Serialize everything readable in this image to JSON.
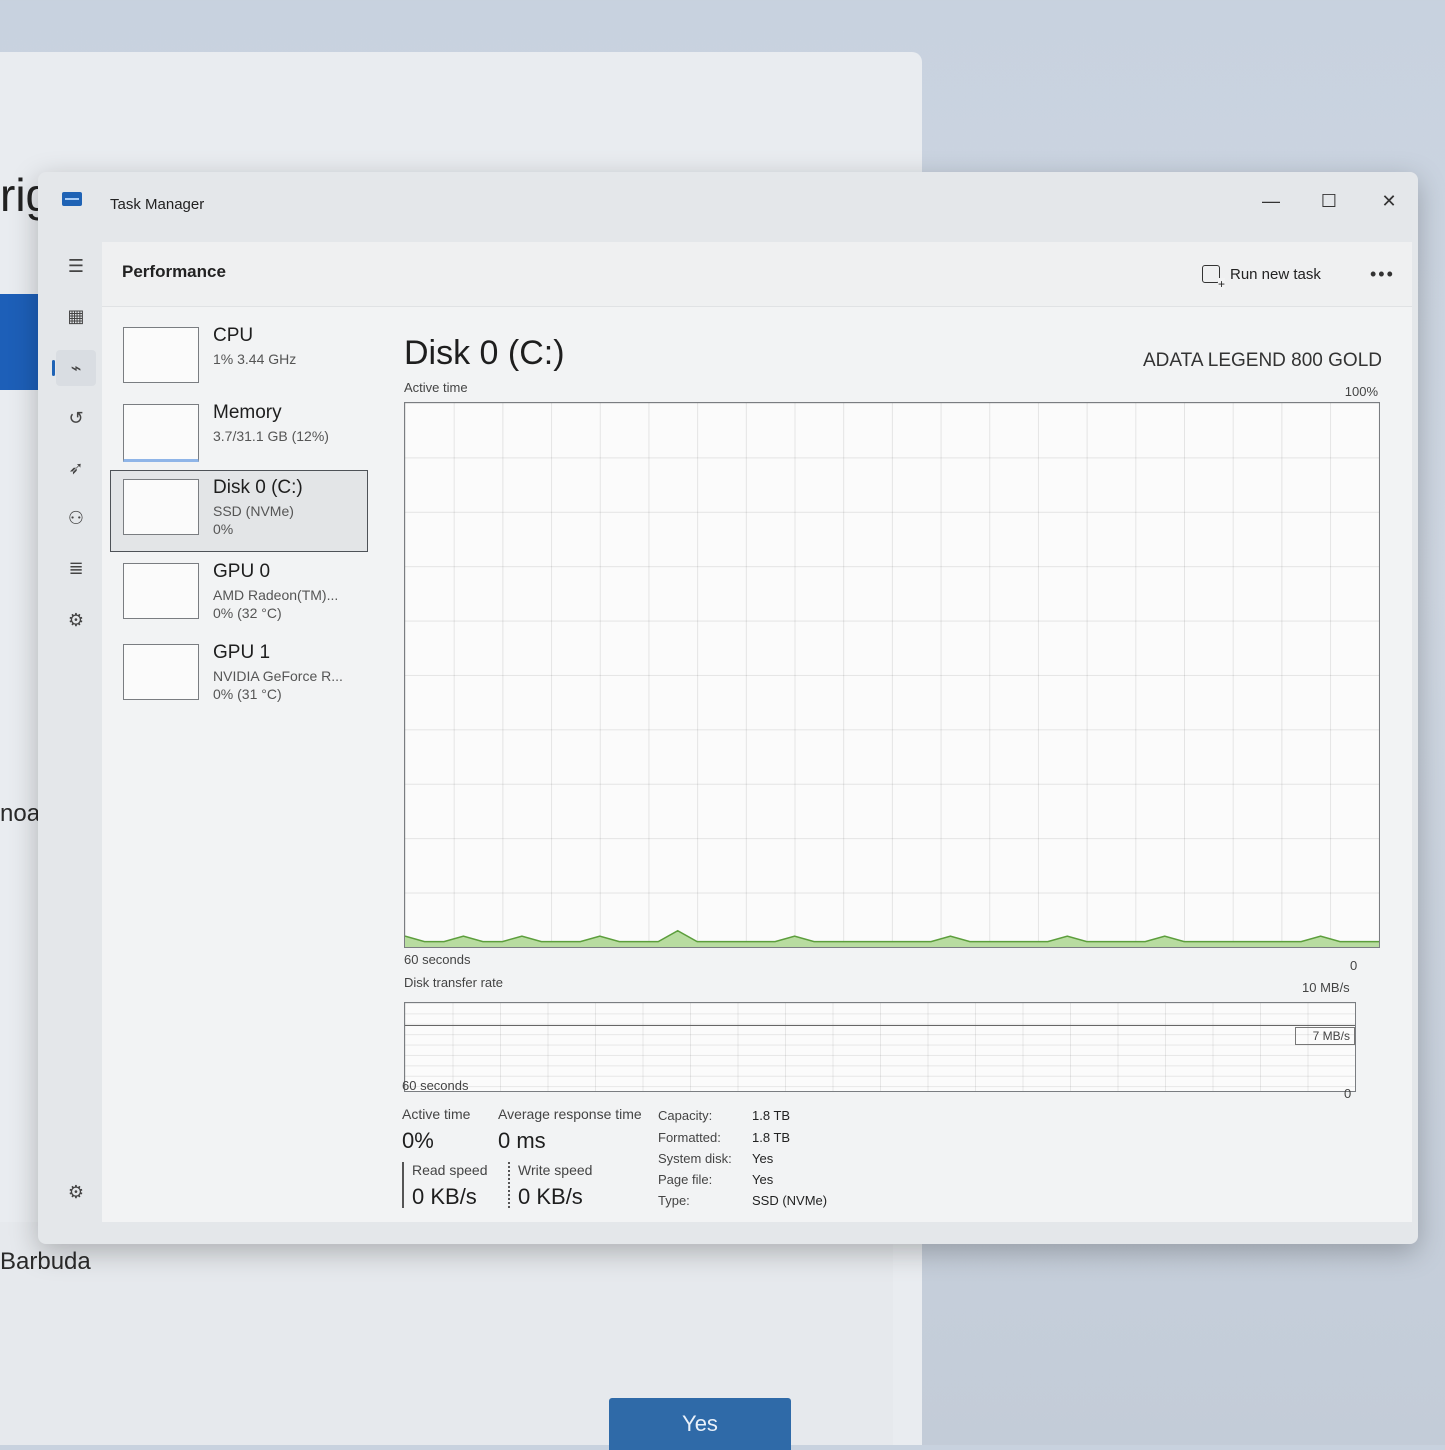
{
  "background": {
    "heading_fragment": "rig",
    "text_fragment_1": "noa",
    "text_fragment_2": "Barbuda",
    "yes_label": "Yes"
  },
  "window": {
    "title": "Task Manager",
    "minimize": "—",
    "maximize": "☐",
    "close": "✕"
  },
  "nav": [
    {
      "name": "hamburger-menu-icon",
      "glyph": "☰"
    },
    {
      "name": "processes-icon",
      "glyph": "▦"
    },
    {
      "name": "performance-icon",
      "glyph": "⌁"
    },
    {
      "name": "app-history-icon",
      "glyph": "↺"
    },
    {
      "name": "startup-apps-icon",
      "glyph": "➶"
    },
    {
      "name": "users-icon",
      "glyph": "⚇"
    },
    {
      "name": "details-icon",
      "glyph": "≣"
    },
    {
      "name": "services-icon",
      "glyph": "⚙"
    },
    {
      "name": "settings-icon",
      "glyph": "⚙"
    }
  ],
  "header": {
    "title": "Performance",
    "run_new_task": "Run new task",
    "more": "•••"
  },
  "devices": [
    {
      "name": "CPU",
      "sub1": "1% 3.44 GHz",
      "sub2": ""
    },
    {
      "name": "Memory",
      "sub1": "3.7/31.1 GB (12%)",
      "sub2": ""
    },
    {
      "name": "Disk 0 (C:)",
      "sub1": "SSD (NVMe)",
      "sub2": "0%"
    },
    {
      "name": "GPU 0",
      "sub1": "AMD Radeon(TM)...",
      "sub2": "0% (32 °C)"
    },
    {
      "name": "GPU 1",
      "sub1": "NVIDIA GeForce R...",
      "sub2": "0% (31 °C)"
    }
  ],
  "detail": {
    "title": "Disk 0 (C:)",
    "model": "ADATA LEGEND 800 GOLD",
    "active_time_label": "Active time",
    "max_label": "100%",
    "seconds_label": "60 seconds",
    "zero_label": "0",
    "transfer_label": "Disk transfer rate",
    "transfer_max": "10 MB/s",
    "transfer_line": "7 MB/s",
    "transfer_seconds": "60 seconds",
    "transfer_zero": "0"
  },
  "stats": {
    "active_time_label": "Active time",
    "active_time_value": "0%",
    "avg_resp_label": "Average response time",
    "avg_resp_value": "0 ms",
    "read_label": "Read speed",
    "read_value": "0 KB/s",
    "write_label": "Write speed",
    "write_value": "0 KB/s"
  },
  "properties": [
    {
      "label": "Capacity:",
      "value": "1.8 TB"
    },
    {
      "label": "Formatted:",
      "value": "1.8 TB"
    },
    {
      "label": "System disk:",
      "value": "Yes"
    },
    {
      "label": "Page file:",
      "value": "Yes"
    },
    {
      "label": "Type:",
      "value": "SSD (NVMe)"
    }
  ],
  "colors": {
    "accent": "#1f63b5",
    "graph_fill": "#b8dca0",
    "graph_line": "#5c9e3c"
  },
  "active_time_series": [
    2,
    1,
    1,
    2,
    1,
    1,
    2,
    1,
    1,
    1,
    2,
    1,
    1,
    1,
    3,
    1,
    1,
    1,
    1,
    1,
    2,
    1,
    1,
    1,
    1,
    1,
    1,
    1,
    2,
    1,
    1,
    1,
    1,
    1,
    2,
    1,
    1,
    1,
    1,
    2,
    1,
    1,
    1,
    1,
    1,
    1,
    1,
    2,
    1,
    1,
    1
  ]
}
